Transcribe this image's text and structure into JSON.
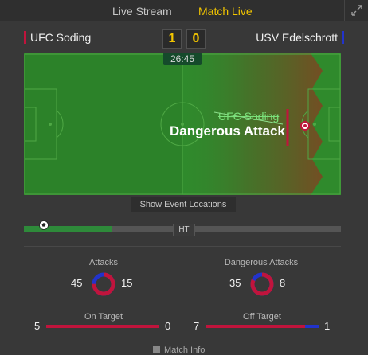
{
  "tabs": [
    {
      "label": "Live Stream",
      "active": false
    },
    {
      "label": "Match Live",
      "active": true
    }
  ],
  "header": {
    "expand_icon": "expand-icon"
  },
  "match": {
    "home_team": "UFC Soding",
    "away_team": "USV Edelschrott",
    "home_score": "1",
    "away_score": "0",
    "clock": "26:45",
    "home_color": "#c0143c",
    "away_color": "#2233cc"
  },
  "event": {
    "team": "UFC Soding",
    "name": "Dangerous Attack"
  },
  "show_locations_label": "Show Event Locations",
  "timeline": {
    "ht_label": "HT",
    "progress": 0.28
  },
  "stats": {
    "attacks": {
      "label": "Attacks",
      "home": "45",
      "away": "15"
    },
    "dangerous_attacks": {
      "label": "Dangerous Attacks",
      "home": "35",
      "away": "8"
    },
    "on_target": {
      "label": "On Target",
      "home": "5",
      "away": "0"
    },
    "off_target": {
      "label": "Off Target",
      "home": "7",
      "away": "1"
    }
  },
  "footer": {
    "match_info_label": "Match Info"
  }
}
